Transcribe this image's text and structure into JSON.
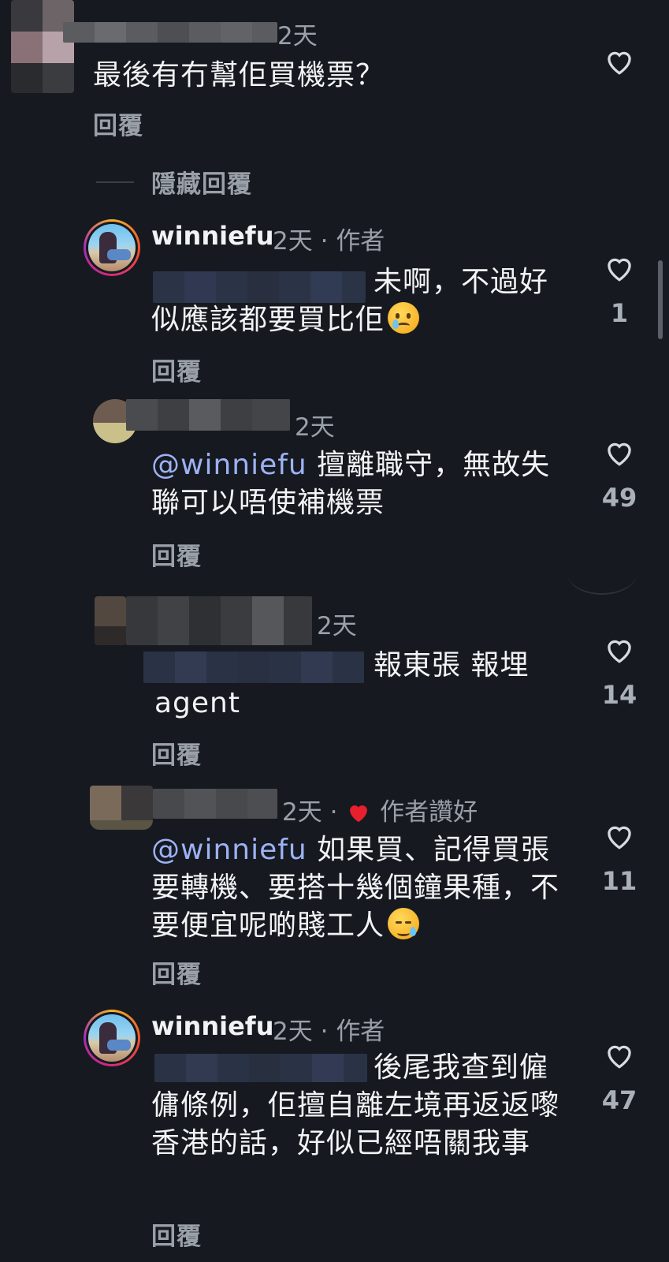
{
  "comments": [
    {
      "time": "2天",
      "text": "最後有冇幫佢買機票？",
      "reply": "回覆"
    },
    {
      "hide_replies": "隱藏回覆"
    },
    {
      "username": "winniefu",
      "time": "2天",
      "role": "作者",
      "text": "未啊，不過好似應該都要買比佢",
      "reply": "回覆",
      "likes": "1"
    },
    {
      "time": "2天",
      "mention": "@winniefu",
      "text": "擅離職守，無故失聯可以唔使補機票",
      "reply": "回覆",
      "likes": "49"
    },
    {
      "time": "2天",
      "text": "報東張 報埋",
      "text2": "agent",
      "reply": "回覆",
      "likes": "14"
    },
    {
      "time": "2天",
      "author_liked": "作者讚好",
      "mention": "@winniefu",
      "text": "如果買、記得買張要轉機、要搭十幾個鐘果種，不要便宜呢啲賤工人",
      "reply": "回覆",
      "likes": "11"
    },
    {
      "username": "winniefu",
      "time": "2天",
      "role": "作者",
      "text": "後尾我查到僱傭條例，佢擅自離左境再返返嚟香港的話，好似已經唔關我事",
      "reply": "回覆",
      "likes": "47"
    }
  ],
  "dot": "·",
  "colors": {
    "background": "#16191f",
    "mention": "#9db2f5",
    "author_liked_heart": "#e8202d"
  }
}
